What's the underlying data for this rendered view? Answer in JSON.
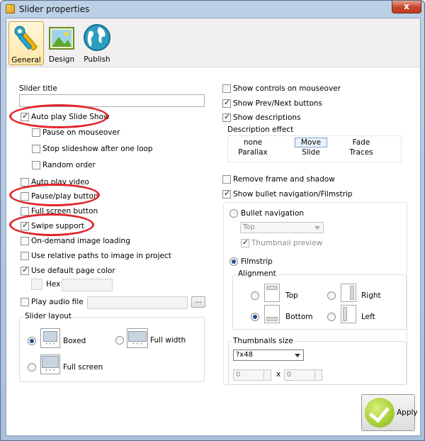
{
  "window": {
    "title": "Slider properties",
    "close_label": "x"
  },
  "tabs": [
    {
      "label": "General",
      "icon": "wrench-icon",
      "active": true
    },
    {
      "label": "Design",
      "icon": "picture-icon",
      "active": false
    },
    {
      "label": "Publish",
      "icon": "globe-icon",
      "active": false
    }
  ],
  "left": {
    "slider_title_label": "Slider title",
    "slider_title_value": "",
    "auto_play": "Auto play Slide Show",
    "pause_on_mouseover": "Pause on mouseover",
    "stop_after_loop": "Stop slideshow after one loop",
    "random_order": "Random order",
    "auto_play_video": "Auto play video",
    "pause_play_button": "Pause/play button",
    "full_screen_button": "Full screen button",
    "swipe_support": "Swipe support",
    "on_demand_loading": "On-demand image loading",
    "relative_paths": "Use relative paths to image in project",
    "default_page_color": "Use default page color",
    "hex_label": "Hex",
    "hex_value": "",
    "play_audio_file": "Play audio file",
    "audio_file_value": "",
    "browse_label": "...",
    "slider_layout_title": "Slider layout",
    "layout_boxed": "Boxed",
    "layout_full_width": "Full width",
    "layout_full_screen": "Full screen"
  },
  "right": {
    "show_controls_mouseover": "Show controls on mouseover",
    "show_prev_next": "Show Prev/Next buttons",
    "show_descriptions": "Show descriptions",
    "description_effect_label": "Description effect",
    "effects": [
      "none",
      "Move",
      "Fade",
      "Parallax",
      "Slide",
      "Traces"
    ],
    "selected_effect": "Move",
    "remove_frame": "Remove frame and shadow",
    "show_bullet_nav": "Show bullet navigation/Filmstrip",
    "bullet_navigation": "Bullet navigation",
    "bullet_position_value": "Top",
    "thumbnail_preview": "Thumbnail preview",
    "filmstrip": "Filmstrip",
    "alignment_title": "Alignment",
    "align_top": "Top",
    "align_right": "Right",
    "align_bottom": "Bottom",
    "align_left": "Left",
    "thumbnails_size_title": "Thumbnails size",
    "thumb_size_value": "?x48",
    "thumb_width": "0",
    "thumb_height": "0",
    "times_sign": "x"
  },
  "apply_label": "Apply",
  "colors": {
    "highlight_red": "#e0262a",
    "accent_green": "#9ec82e",
    "title_bar": "#bcd0e6"
  }
}
